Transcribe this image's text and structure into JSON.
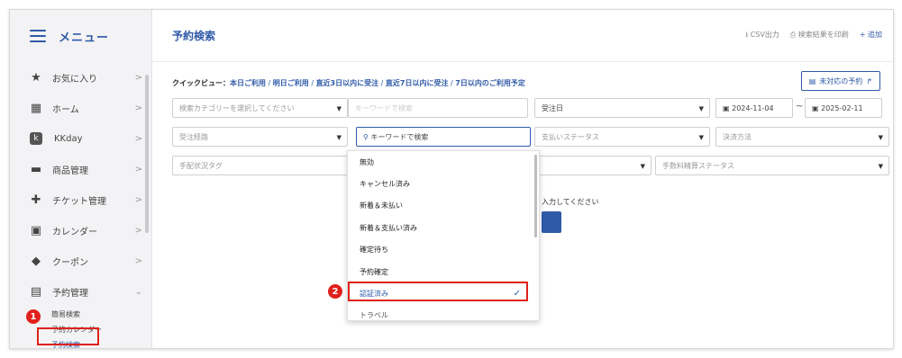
{
  "sidebar": {
    "title": "メニュー",
    "items": [
      {
        "label": "お気に入り",
        "icon": "star-icon",
        "glyph": "★"
      },
      {
        "label": "ホーム",
        "icon": "grid-icon",
        "glyph": "▦"
      },
      {
        "label": "KKday",
        "icon": "kkday-logo-icon",
        "glyph": "k"
      },
      {
        "label": "商品管理",
        "icon": "folder-icon",
        "glyph": "▬"
      },
      {
        "label": "チケット管理",
        "icon": "ticket-icon",
        "glyph": "✚"
      },
      {
        "label": "カレンダー",
        "icon": "calendar-icon",
        "glyph": "▣"
      },
      {
        "label": "クーポン",
        "icon": "tag-icon",
        "glyph": "◆"
      },
      {
        "label": "予約管理",
        "icon": "document-icon",
        "glyph": "▤"
      }
    ],
    "sub_items": [
      "簡易検索",
      "予約カレンダー",
      "予約検索"
    ]
  },
  "header": {
    "title": "予約検索",
    "csv": "CSV出力",
    "print": "検索結果を印刷",
    "add": "追加"
  },
  "quick_view": {
    "label": "クイックビュー：",
    "links": [
      "本日ご利用",
      "明日ご利用",
      "直近3日以内に受注",
      "直近7日以内に受注",
      "7日以内のご利用予定"
    ],
    "separator": " / "
  },
  "unhandled_button": "未対応の予約",
  "filters": {
    "category_placeholder": "検索カテゴリーを選択してください",
    "keyword_placeholder": "キーワードで検索",
    "date_type": "受注日",
    "date_from": "2024-11-04",
    "date_to": "2025-02-11",
    "range_sep": "~",
    "channel_placeholder": "受注経路",
    "dropdown_search": "キーワードで検索",
    "payment_status_placeholder": "支払いステータス",
    "payment_method_placeholder": "決済方法",
    "arrangement_placeholder": "手配状況タグ",
    "fee_status_placeholder": "手数料精算ステータス"
  },
  "dropdown_options": [
    "無効",
    "キャンセル済み",
    "新着＆未払い",
    "新着＆支払い済み",
    "確定待ち",
    "予約確定",
    "認証済み",
    "トラベル"
  ],
  "selected_option": "認証済み",
  "hint_text": "入力してください",
  "annotations": {
    "step1": "1",
    "step2": "2",
    "highlight_color": "#e0201b"
  },
  "colors": {
    "accent": "#2f5aa8",
    "sidebar_bg": "#f3f3f5"
  }
}
